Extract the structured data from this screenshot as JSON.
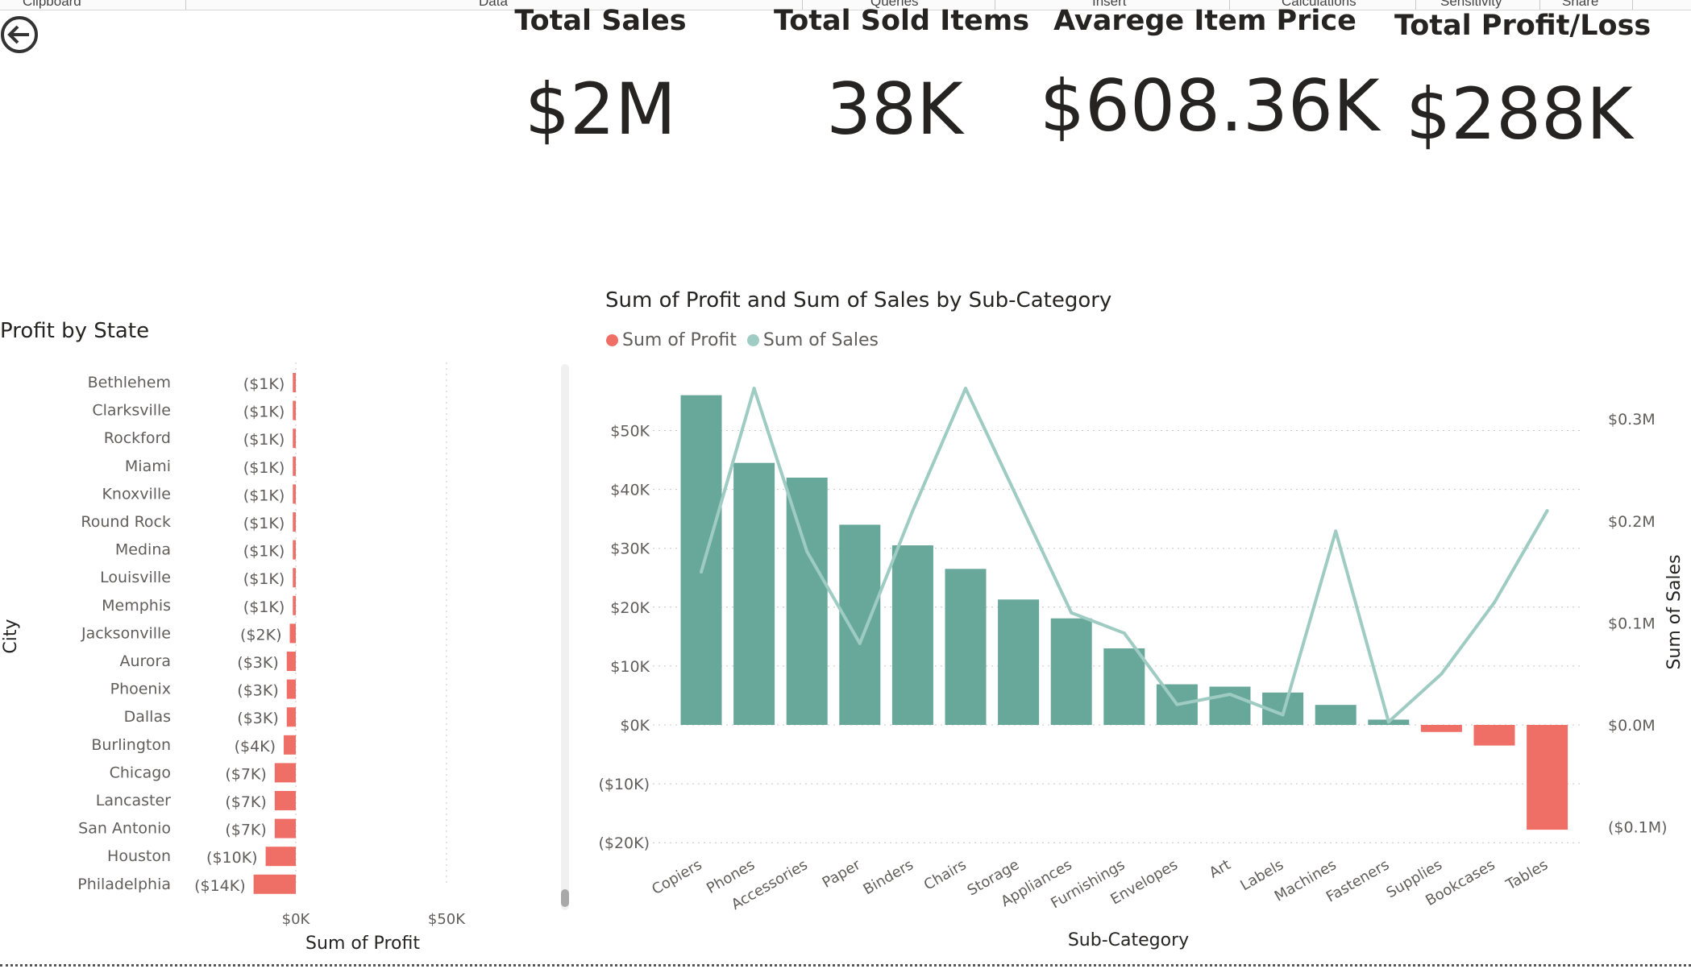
{
  "ribbon": {
    "labels": [
      "Clipboard",
      "Data",
      "Queries",
      "Insert",
      "Calculations",
      "Sensitivity",
      "Share"
    ]
  },
  "kpis": [
    {
      "title": "Total Sales",
      "value": "$2M"
    },
    {
      "title": "Total Sold Items",
      "value": "38K"
    },
    {
      "title": "Avarege Item Price",
      "value": "$608.36K"
    },
    {
      "title": "Total Profit/Loss",
      "value": "$288K"
    }
  ],
  "colors": {
    "profit": "#ef6f67",
    "sales_bar": "#68a89b",
    "sales_line": "#9ecbc2",
    "text": "#252423",
    "axis_text": "#605e5c"
  },
  "left_chart": {
    "title": "Profit by State",
    "ylabel": "City",
    "xlabel": "Sum of Profit",
    "x_ticks": [
      "$0K",
      "$50K"
    ]
  },
  "right_chart": {
    "title": "Sum of Profit and Sum of Sales by Sub-Category",
    "legend": [
      "Sum of Profit",
      "Sum of Sales"
    ],
    "xlabel": "Sub-Category",
    "y2label": "Sum of Sales",
    "y_ticks": [
      "$50K",
      "$40K",
      "$30K",
      "$20K",
      "$10K",
      "$0K",
      "($10K)",
      "($20K)"
    ],
    "y2_ticks": [
      "$0.3M",
      "$0.2M",
      "$0.1M",
      "$0.0M",
      "($0.1M)"
    ]
  },
  "chart_data": [
    {
      "type": "bar",
      "orientation": "horizontal",
      "title": "Profit by State",
      "xlabel": "Sum of Profit",
      "ylabel": "City",
      "xlim": [
        -15000,
        85000
      ],
      "categories": [
        "Bethlehem",
        "Clarksville",
        "Rockford",
        "Miami",
        "Knoxville",
        "Round Rock",
        "Medina",
        "Louisville",
        "Memphis",
        "Jacksonville",
        "Aurora",
        "Phoenix",
        "Dallas",
        "Burlington",
        "Chicago",
        "Lancaster",
        "San Antonio",
        "Houston",
        "Philadelphia"
      ],
      "values": [
        -1000,
        -1000,
        -1000,
        -1000,
        -1000,
        -1000,
        -1000,
        -1000,
        -1000,
        -2000,
        -3000,
        -3000,
        -3000,
        -4000,
        -7000,
        -7000,
        -7000,
        -10000,
        -14000
      ],
      "labels": [
        "($1K)",
        "($1K)",
        "($1K)",
        "($1K)",
        "($1K)",
        "($1K)",
        "($1K)",
        "($1K)",
        "($1K)",
        "($2K)",
        "($3K)",
        "($3K)",
        "($3K)",
        "($4K)",
        "($7K)",
        "($7K)",
        "($7K)",
        "($10K)",
        "($14K)"
      ],
      "grid": true
    },
    {
      "type": "bar",
      "combo": "bar+line",
      "title": "Sum of Profit and Sum of Sales by Sub-Category",
      "xlabel": "Sub-Category",
      "ylabel": "",
      "y2label": "Sum of Sales",
      "ylim": [
        -20000,
        56000
      ],
      "y2lim": [
        -0.1,
        0.326
      ],
      "categories": [
        "Copiers",
        "Phones",
        "Accessories",
        "Paper",
        "Binders",
        "Chairs",
        "Storage",
        "Appliances",
        "Furnishings",
        "Envelopes",
        "Art",
        "Labels",
        "Machines",
        "Fasteners",
        "Supplies",
        "Bookcases",
        "Tables"
      ],
      "series": [
        {
          "name": "Sum of Profit",
          "type": "bar",
          "axis": "left",
          "values": [
            56000,
            44500,
            42000,
            34000,
            30500,
            26500,
            21300,
            18100,
            13000,
            6900,
            6500,
            5500,
            3400,
            900,
            -1200,
            -3500,
            -17800
          ]
        },
        {
          "name": "Sum of Sales",
          "type": "line",
          "axis": "right",
          "unit": "$M",
          "values": [
            0.15,
            0.33,
            0.17,
            0.08,
            0.21,
            0.33,
            0.22,
            0.11,
            0.09,
            0.02,
            0.03,
            0.01,
            0.19,
            0.003,
            0.05,
            0.12,
            0.21
          ]
        }
      ],
      "grid": true,
      "legend_position": "top-left"
    }
  ]
}
